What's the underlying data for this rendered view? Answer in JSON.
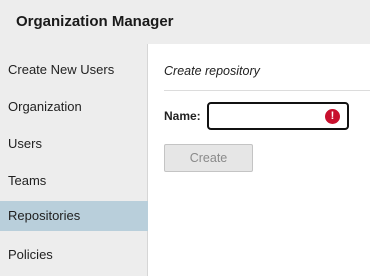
{
  "app": {
    "title": "Organization Manager"
  },
  "sidebar": {
    "items": [
      {
        "label": "Create New Users"
      },
      {
        "label": "Organization"
      },
      {
        "label": "Users"
      },
      {
        "label": "Teams"
      },
      {
        "label": "Repositories",
        "active": true
      },
      {
        "label": "Policies"
      }
    ]
  },
  "main": {
    "section_title": "Create repository",
    "form": {
      "name_label": "Name:",
      "name_value": "",
      "error_icon": "error-exclamation-icon",
      "error_glyph": "!",
      "create_label": "Create",
      "create_disabled": true
    }
  },
  "colors": {
    "header_bg": "#ededed",
    "sidebar_bg": "#ededed",
    "active_item_bg": "#b9cfdb",
    "error_red": "#c8102e",
    "disabled_button_bg": "#e6e6e6"
  }
}
